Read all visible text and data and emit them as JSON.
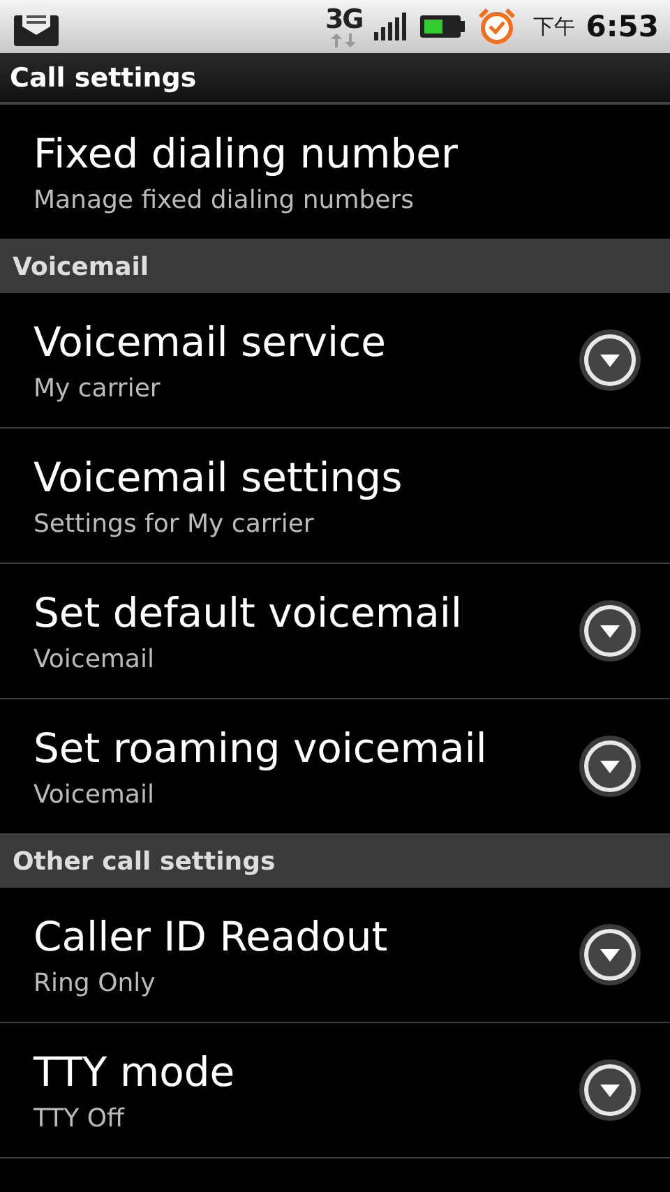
{
  "status_bar": {
    "network": "3G",
    "ampm": "下午",
    "time": "6:53"
  },
  "title": "Call settings",
  "sections": [
    {
      "items": [
        {
          "title": "Fixed dialing number",
          "summary": "Manage fixed dialing numbers",
          "kind": "plain"
        }
      ]
    },
    {
      "header": "Voicemail",
      "items": [
        {
          "title": "Voicemail service",
          "summary": "My carrier",
          "kind": "dropdown"
        },
        {
          "title": "Voicemail settings",
          "summary": "Settings for My carrier",
          "kind": "plain"
        },
        {
          "title": "Set default voicemail",
          "summary": "Voicemail",
          "kind": "dropdown"
        },
        {
          "title": "Set roaming voicemail",
          "summary": "Voicemail",
          "kind": "dropdown"
        }
      ]
    },
    {
      "header": "Other call settings",
      "items": [
        {
          "title": "Caller ID Readout",
          "summary": "Ring Only",
          "kind": "dropdown"
        },
        {
          "title": "TTY mode",
          "summary": "TTY Off",
          "kind": "dropdown"
        }
      ]
    }
  ]
}
